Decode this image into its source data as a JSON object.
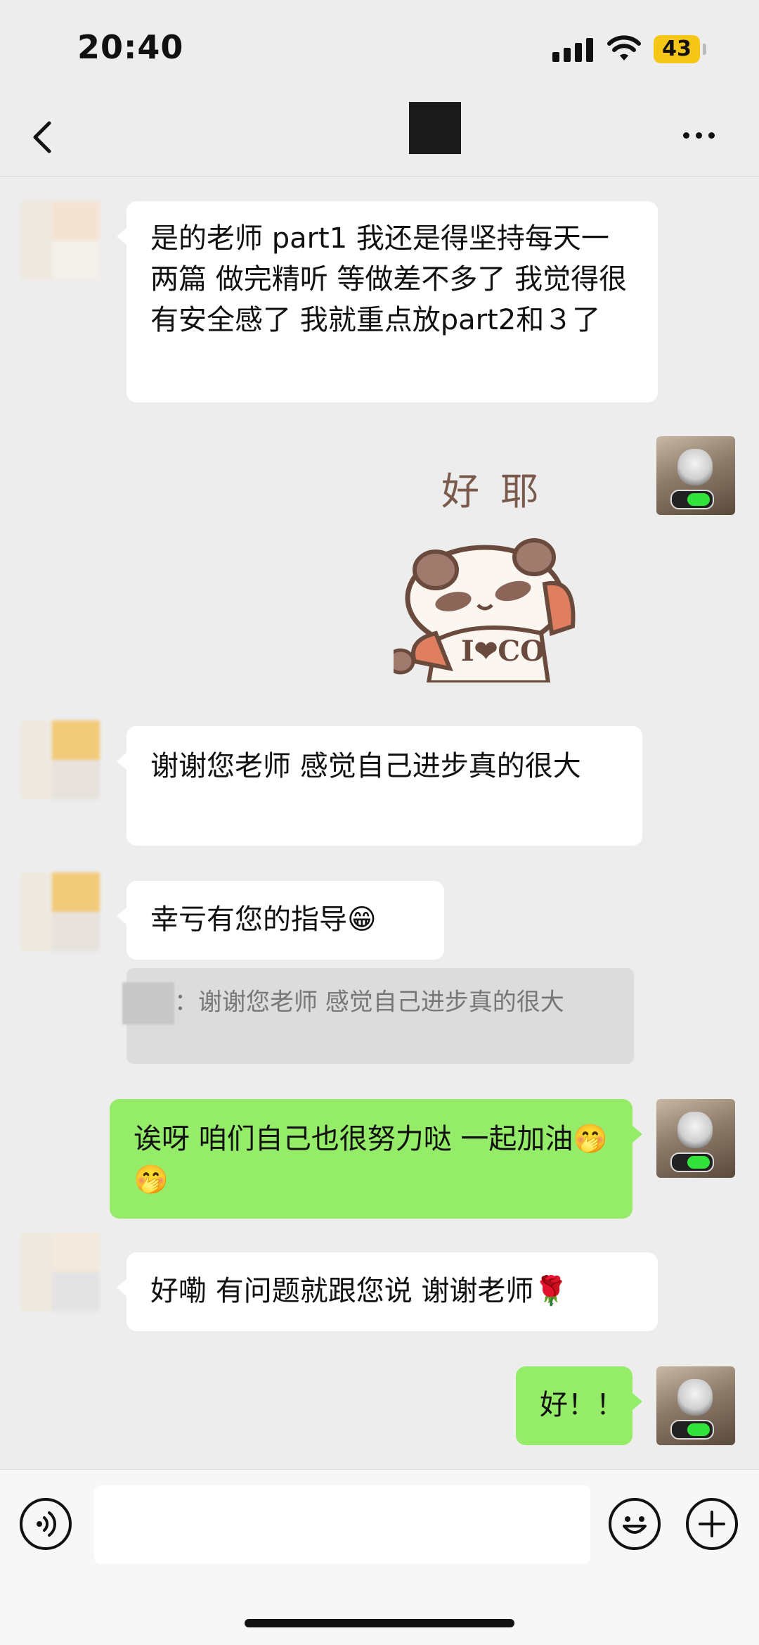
{
  "status_bar": {
    "time": "20:40",
    "battery": "43"
  },
  "nav": {
    "title": ""
  },
  "messages": [
    {
      "side": "left",
      "text": "是的老师 part1 我还是得坚持每天一两篇 做完精听 等做差不多了 我觉得很有安全感了 我就重点放part2和３了"
    },
    {
      "side": "right",
      "type": "sticker",
      "sticker_text": "好耶",
      "sticker_shirt": "I❤CO"
    },
    {
      "side": "left",
      "text": "谢谢您老师 感觉自己进步真的很大"
    },
    {
      "side": "left",
      "text": "幸亏有您的指导😁"
    },
    {
      "side": "left",
      "type": "quote",
      "text": "：谢谢您老师 感觉自己进步真的很大"
    },
    {
      "side": "right",
      "text": "诶呀 咱们自己也很努力哒 一起加油🤭🤭"
    },
    {
      "side": "left",
      "text": "好嘞 有问题就跟您说 谢谢老师🌹"
    },
    {
      "side": "right",
      "text": "好！！"
    }
  ],
  "input": {
    "placeholder": ""
  },
  "icons": {
    "back": "chevron-left-icon",
    "more": "more-icon",
    "voice": "voice-icon",
    "emoji": "emoji-icon",
    "add": "plus-icon"
  },
  "colors": {
    "background": "#ededed",
    "bubble_self": "#95ec69",
    "bubble_other": "#ffffff"
  }
}
